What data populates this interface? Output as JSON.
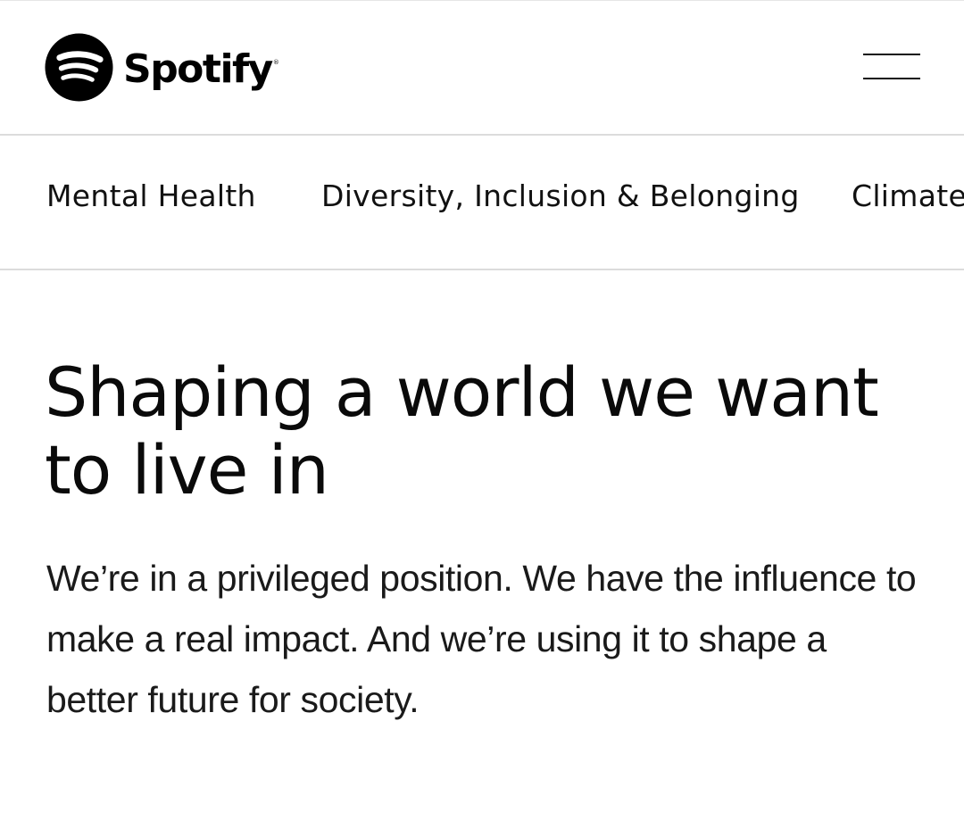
{
  "header": {
    "brand_name": "Spotify",
    "brand_trademark": "®",
    "logo_icon": "spotify-logo-icon",
    "menu_icon": "hamburger-menu-icon"
  },
  "subnav": {
    "items": [
      {
        "label": "Mental Health"
      },
      {
        "label": "Diversity, Inclusion & Belonging"
      },
      {
        "label": "Climate"
      }
    ]
  },
  "main": {
    "title": "Shaping a world we want to live in",
    "intro": "We’re in a privileged position. We have the influence to make a real impact. And we’re using it to shape a better future for society."
  },
  "colors": {
    "text": "#000000",
    "background": "#ffffff",
    "divider": "#dcdcdc"
  }
}
